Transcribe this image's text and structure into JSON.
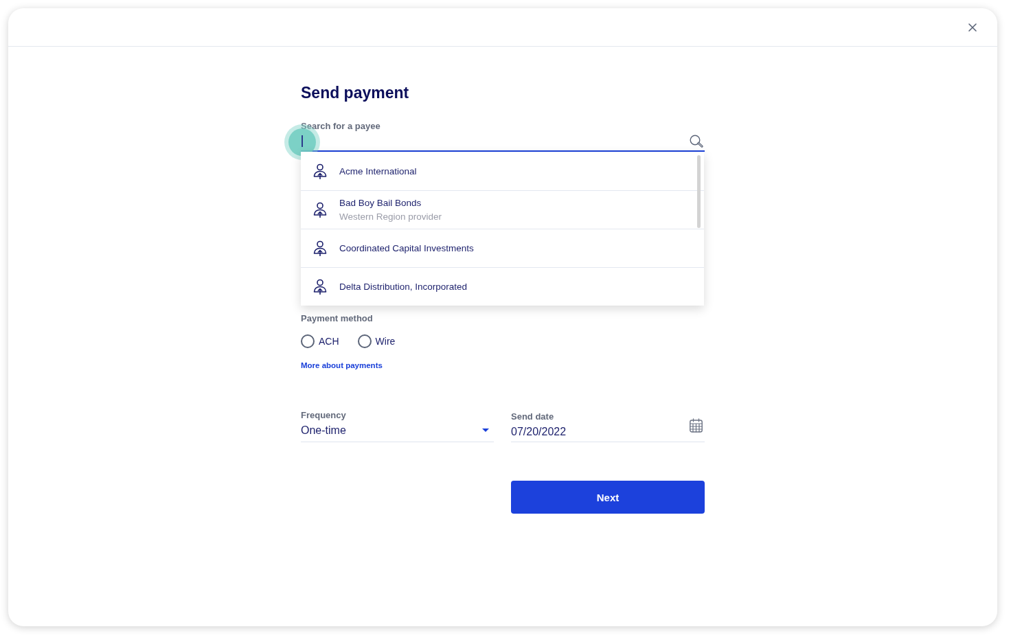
{
  "title": "Send payment",
  "search": {
    "label": "Search for a payee",
    "focused": true,
    "results": [
      {
        "name": "Acme International"
      },
      {
        "name": "Bad Boy Bail Bonds",
        "detail": "Western Region provider"
      },
      {
        "name": "Coordinated Capital Investments"
      },
      {
        "name": "Delta Distribution, Incorporated"
      }
    ]
  },
  "payment_method": {
    "label": "Payment method",
    "options": [
      {
        "label": "ACH",
        "selected": false
      },
      {
        "label": "Wire",
        "selected": false
      }
    ],
    "link": "More about payments"
  },
  "frequency": {
    "label": "Frequency",
    "value": "One-time"
  },
  "send_date": {
    "label": "Send date",
    "value": "07/20/2022"
  },
  "next_button": "Next"
}
